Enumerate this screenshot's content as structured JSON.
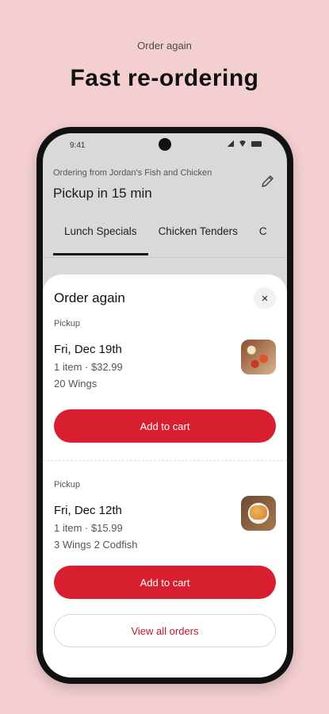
{
  "page": {
    "eyebrow": "Order again",
    "headline": "Fast re-ordering"
  },
  "status_bar": {
    "time": "9:41"
  },
  "header": {
    "ordering_from": "Ordering from Jordan's Fish and Chicken",
    "pickup_time": "Pickup in 15 min"
  },
  "tabs": [
    {
      "label": "Lunch Specials",
      "active": true
    },
    {
      "label": "Chicken Tenders",
      "active": false
    },
    {
      "label": "C",
      "active": false
    }
  ],
  "sheet": {
    "title": "Order again",
    "close_symbol": "×",
    "orders": [
      {
        "type": "Pickup",
        "date": "Fri, Dec 19th",
        "meta": "1 item · $32.99",
        "items": "20 Wings",
        "button": "Add to cart"
      },
      {
        "type": "Pickup",
        "date": "Fri, Dec 12th",
        "meta": "1 item · $15.99",
        "items": "3 Wings 2 Codfish",
        "button": "Add to cart"
      }
    ],
    "view_all": "View all orders"
  },
  "colors": {
    "background": "#f3cfd2",
    "accent": "#d71f30"
  }
}
